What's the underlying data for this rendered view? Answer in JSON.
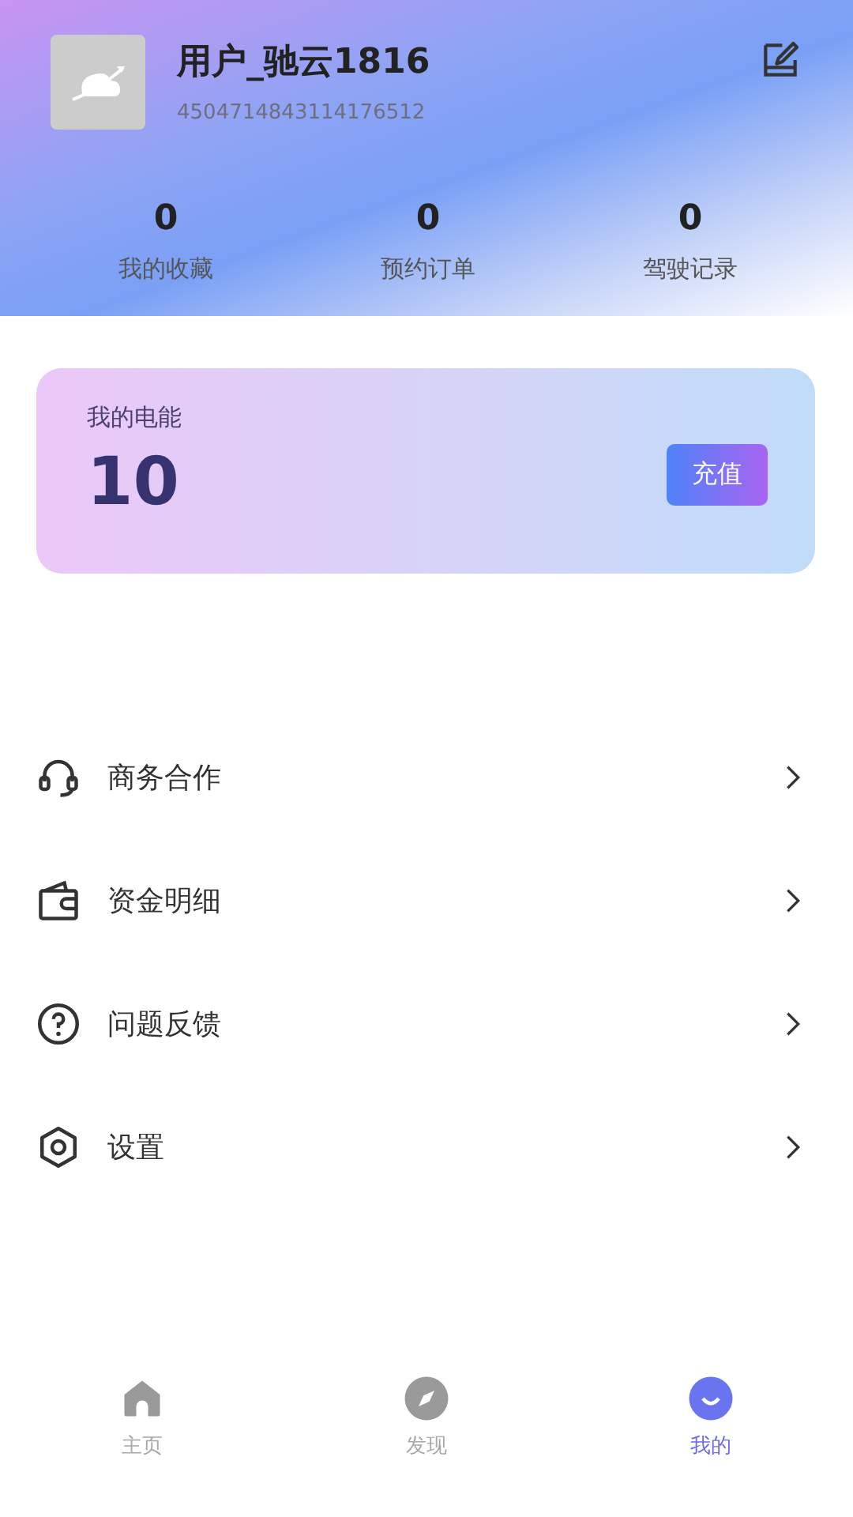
{
  "profile": {
    "username": "用户_驰云1816",
    "user_id": "4504714843114176512"
  },
  "stats": [
    {
      "value": "0",
      "label": "我的收藏"
    },
    {
      "value": "0",
      "label": "预约订单"
    },
    {
      "value": "0",
      "label": "驾驶记录"
    }
  ],
  "energy_card": {
    "title": "我的电能",
    "value": "10",
    "button": "充值"
  },
  "menu": [
    {
      "kind": "headset",
      "label": "商务合作"
    },
    {
      "kind": "wallet",
      "label": "资金明细"
    },
    {
      "kind": "help",
      "label": "问题反馈"
    },
    {
      "kind": "settings",
      "label": "设置"
    }
  ],
  "tab_bar": [
    {
      "kind": "home",
      "label": "主页",
      "selected": false
    },
    {
      "kind": "discover",
      "label": "发现",
      "selected": false
    },
    {
      "kind": "me",
      "label": "我的",
      "selected": true
    }
  ]
}
